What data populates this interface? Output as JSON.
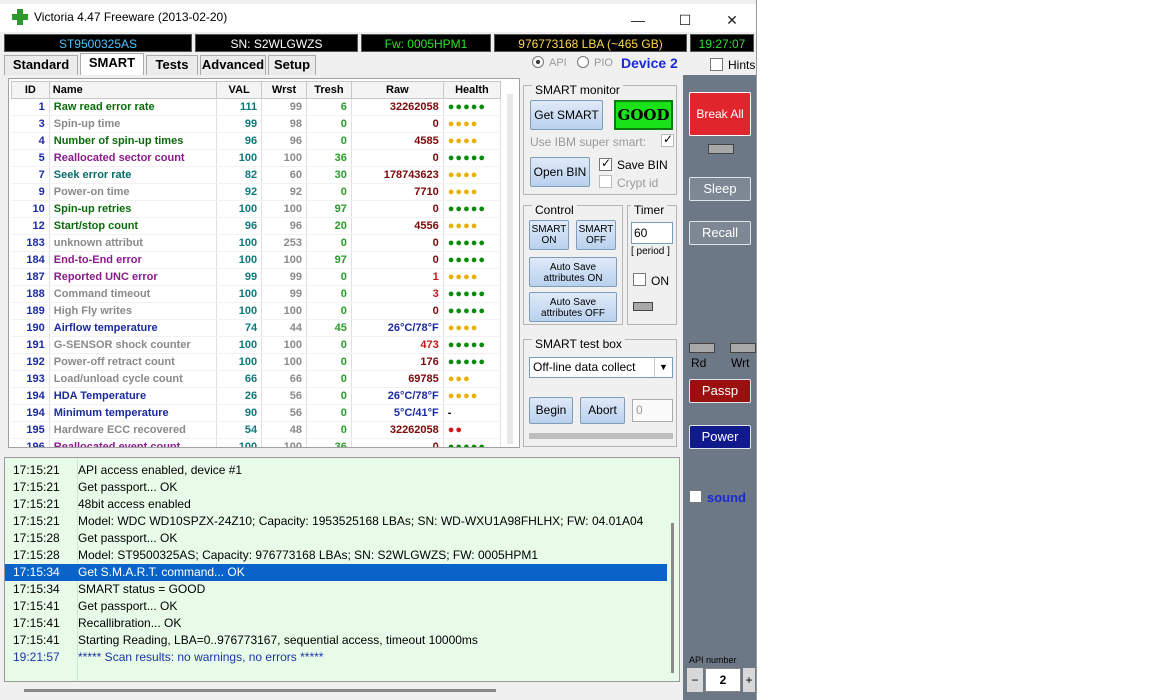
{
  "window": {
    "title": "Victoria 4.47  Freeware (2013-02-20)",
    "minimize_icon": "minimize-icon",
    "maximize_icon": "maximize-icon",
    "close_icon": "close-icon"
  },
  "infobar": {
    "model": "ST9500325AS",
    "serial": "SN: S2WLGWZS",
    "firmware": "Fw: 0005HPM1",
    "lba": "976773168 LBA (~465 GB)",
    "clock": "19:27:07"
  },
  "tabs": [
    "Standard",
    "SMART",
    "Tests",
    "Advanced",
    "Setup"
  ],
  "active_tab": "SMART",
  "mode": {
    "api_label": "API",
    "pio_label": "PIO",
    "selected": "API",
    "device_label": "Device 2",
    "hints_label": "Hints"
  },
  "smart_table": {
    "columns": [
      "ID",
      "Name",
      "VAL",
      "Wrst",
      "Tresh",
      "Raw",
      "Health"
    ],
    "rows": [
      {
        "id": "1",
        "name": "Raw read error rate",
        "val": "111",
        "wrst": "99",
        "tresh": "6",
        "raw": "32262058",
        "health": "●●●●●",
        "color": "#0a6b0a"
      },
      {
        "id": "3",
        "name": "Spin-up time",
        "val": "99",
        "wrst": "98",
        "tresh": "0",
        "raw": "0",
        "health": "●●●●",
        "color": "#8a8a8a"
      },
      {
        "id": "4",
        "name": "Number of spin-up times",
        "val": "96",
        "wrst": "96",
        "tresh": "0",
        "raw": "4585",
        "health": "●●●●",
        "color": "#0a6b0a"
      },
      {
        "id": "5",
        "name": "Reallocated sector count",
        "val": "100",
        "wrst": "100",
        "tresh": "36",
        "raw": "0",
        "health": "●●●●●",
        "color": "#8b1a8b"
      },
      {
        "id": "7",
        "name": "Seek error rate",
        "val": "82",
        "wrst": "60",
        "tresh": "30",
        "raw": "178743623",
        "health": "●●●●",
        "color": "#0a6b6b"
      },
      {
        "id": "9",
        "name": "Power-on time",
        "val": "92",
        "wrst": "92",
        "tresh": "0",
        "raw": "7710",
        "health": "●●●●",
        "color": "#8a8a8a"
      },
      {
        "id": "10",
        "name": "Spin-up retries",
        "val": "100",
        "wrst": "100",
        "tresh": "97",
        "raw": "0",
        "health": "●●●●●",
        "color": "#0a6b0a"
      },
      {
        "id": "12",
        "name": "Start/stop count",
        "val": "96",
        "wrst": "96",
        "tresh": "20",
        "raw": "4556",
        "health": "●●●●",
        "color": "#0a6b0a"
      },
      {
        "id": "183",
        "name": "unknown attribut",
        "val": "100",
        "wrst": "253",
        "tresh": "0",
        "raw": "0",
        "health": "●●●●●",
        "color": "#8a8a8a"
      },
      {
        "id": "184",
        "name": "End-to-End error",
        "val": "100",
        "wrst": "100",
        "tresh": "97",
        "raw": "0",
        "health": "●●●●●",
        "color": "#8b1a8b"
      },
      {
        "id": "187",
        "name": "Reported UNC error",
        "val": "99",
        "wrst": "99",
        "tresh": "0",
        "raw": "1",
        "health": "●●●●",
        "color": "#8b1a8b"
      },
      {
        "id": "188",
        "name": "Command timeout",
        "val": "100",
        "wrst": "99",
        "tresh": "0",
        "raw": "3",
        "health": "●●●●●",
        "color": "#8a8a8a"
      },
      {
        "id": "189",
        "name": "High Fly writes",
        "val": "100",
        "wrst": "100",
        "tresh": "0",
        "raw": "0",
        "health": "●●●●●",
        "color": "#8a8a8a"
      },
      {
        "id": "190",
        "name": "Airflow temperature",
        "val": "74",
        "wrst": "44",
        "tresh": "45",
        "raw": "26°C/78°F",
        "health": "●●●●",
        "color": "#1a2aa0"
      },
      {
        "id": "191",
        "name": "G-SENSOR shock counter",
        "val": "100",
        "wrst": "100",
        "tresh": "0",
        "raw": "473",
        "health": "●●●●●",
        "color": "#8a8a8a"
      },
      {
        "id": "192",
        "name": "Power-off retract count",
        "val": "100",
        "wrst": "100",
        "tresh": "0",
        "raw": "176",
        "health": "●●●●●",
        "color": "#8a8a8a"
      },
      {
        "id": "193",
        "name": "Load/unload cycle count",
        "val": "66",
        "wrst": "66",
        "tresh": "0",
        "raw": "69785",
        "health": "●●●",
        "color": "#8a8a8a"
      },
      {
        "id": "194",
        "name": "HDA Temperature",
        "val": "26",
        "wrst": "56",
        "tresh": "0",
        "raw": "26°C/78°F",
        "health": "●●●●",
        "color": "#1a2aa0"
      },
      {
        "id": "194",
        "name": "Minimum temperature",
        "val": "90",
        "wrst": "56",
        "tresh": "0",
        "raw": "5°C/41°F",
        "health": "-",
        "color": "#1a2aa0"
      },
      {
        "id": "195",
        "name": "Hardware ECC recovered",
        "val": "54",
        "wrst": "48",
        "tresh": "0",
        "raw": "32262058",
        "health": "●●",
        "color": "#8a8a8a"
      },
      {
        "id": "196",
        "name": "Reallocated event count",
        "val": "100",
        "wrst": "100",
        "tresh": "36",
        "raw": "0",
        "health": "●●●●●",
        "color": "#8b1a8b"
      }
    ]
  },
  "smart_monitor": {
    "caption": "SMART monitor",
    "get_smart": "Get SMART",
    "status": "GOOD",
    "use_ibm": "Use IBM super smart:",
    "open_bin": "Open BIN",
    "save_bin": "Save BIN",
    "crypt_id": "Crypt id"
  },
  "control": {
    "caption": "Control",
    "smart_on": "SMART ON",
    "smart_off": "SMART OFF",
    "autosave_on": "Auto Save attributes ON",
    "autosave_off": "Auto Save attributes OFF"
  },
  "timer": {
    "caption": "Timer",
    "value": "60",
    "period": "[ period ]",
    "on_label": "ON"
  },
  "test_box": {
    "caption": "SMART test box",
    "selected": "Off-line data collect",
    "begin": "Begin",
    "abort": "Abort",
    "progress": "0"
  },
  "log": [
    {
      "time": "17:15:21",
      "msg": "API access enabled, device #1"
    },
    {
      "time": "17:15:21",
      "msg": "Get passport... OK"
    },
    {
      "time": "17:15:21",
      "msg": "48bit access enabled"
    },
    {
      "time": "17:15:21",
      "msg": "Model: WDC WD10SPZX-24Z10; Capacity: 1953525168 LBAs; SN: WD-WXU1A98FHLHX; FW: 04.01A04"
    },
    {
      "time": "17:15:28",
      "msg": "Get passport... OK"
    },
    {
      "time": "17:15:28",
      "msg": "Model: ST9500325AS; Capacity: 976773168 LBAs; SN: S2WLGWZS; FW: 0005HPM1"
    },
    {
      "time": "17:15:34",
      "msg": "Get S.M.A.R.T. command... OK",
      "selected": true
    },
    {
      "time": "17:15:34",
      "msg": "SMART status = GOOD"
    },
    {
      "time": "17:15:41",
      "msg": "Get passport... OK"
    },
    {
      "time": "17:15:41",
      "msg": "Recallibration... OK"
    },
    {
      "time": "17:15:41",
      "msg": "Starting Reading, LBA=0..976773167, sequential access, timeout 10000ms"
    },
    {
      "time": "19:21:57",
      "msg": "***** Scan results: no warnings, no errors *****",
      "blue": true
    }
  ],
  "sidebar": {
    "break_all": "Break All",
    "sleep": "Sleep",
    "recall": "Recall",
    "rd": "Rd",
    "wrt": "Wrt",
    "passp": "Passp",
    "power": "Power",
    "sound": "sound",
    "api_number_label": "API number",
    "api_number": "2",
    "minus": "−",
    "plus": "+"
  }
}
